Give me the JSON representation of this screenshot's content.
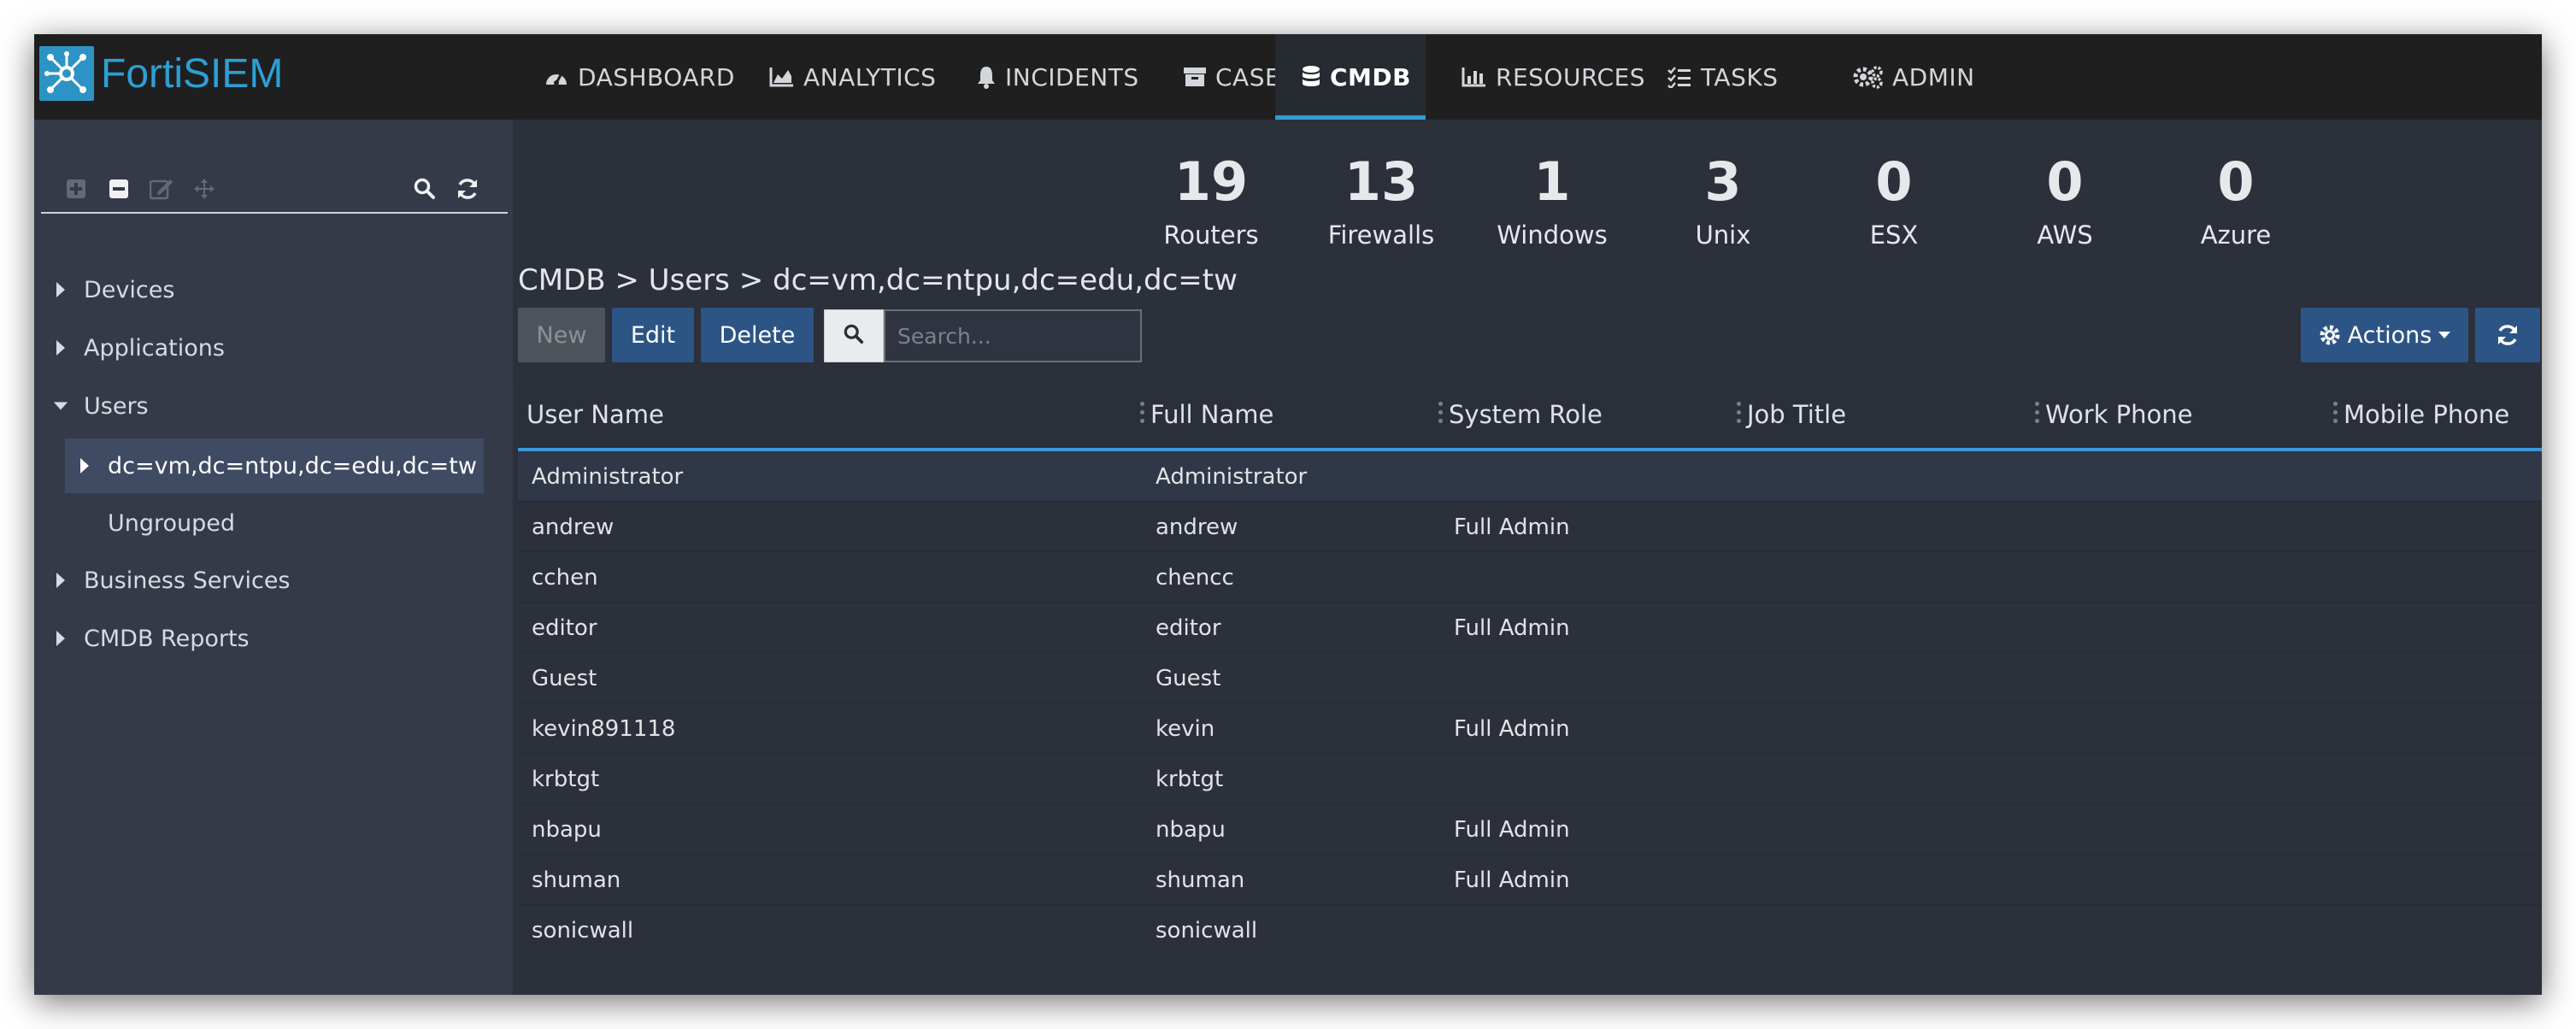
{
  "app": {
    "logo_text": "FortiSIEM"
  },
  "nav": [
    {
      "label": "DASHBOARD",
      "icon": "dashboard-icon"
    },
    {
      "label": "ANALYTICS",
      "icon": "analytics-chart-icon"
    },
    {
      "label": "INCIDENTS",
      "icon": "bell-icon"
    },
    {
      "label": "CASES",
      "icon": "archive-icon"
    },
    {
      "label": "CMDB",
      "icon": "database-icon",
      "active": true
    },
    {
      "label": "RESOURCES",
      "icon": "bar-chart-icon"
    },
    {
      "label": "TASKS",
      "icon": "task-list-icon"
    },
    {
      "label": "ADMIN",
      "icon": "gears-icon"
    }
  ],
  "sidebar": {
    "tools": [
      "add-icon",
      "remove-icon",
      "edit-icon",
      "move-icon",
      "search-icon",
      "refresh-icon"
    ],
    "tree": [
      {
        "label": "Devices",
        "state": "collapsed"
      },
      {
        "label": "Applications",
        "state": "collapsed"
      },
      {
        "label": "Users",
        "state": "expanded"
      },
      {
        "label": "dc=vm,dc=ntpu,dc=edu,dc=tw",
        "state": "collapsed",
        "child": true,
        "selected": true
      },
      {
        "label": "Ungrouped",
        "state": "leaf",
        "child": true
      },
      {
        "label": "Business Services",
        "state": "collapsed"
      },
      {
        "label": "CMDB Reports",
        "state": "collapsed"
      }
    ]
  },
  "stats": [
    {
      "value": "19",
      "label": "Routers"
    },
    {
      "value": "13",
      "label": "Firewalls"
    },
    {
      "value": "1",
      "label": "Windows"
    },
    {
      "value": "3",
      "label": "Unix"
    },
    {
      "value": "0",
      "label": "ESX"
    },
    {
      "value": "0",
      "label": "AWS"
    },
    {
      "value": "0",
      "label": "Azure"
    }
  ],
  "breadcrumb": "CMDB > Users > dc=vm,dc=ntpu,dc=edu,dc=tw",
  "toolbar": {
    "new_label": "New",
    "edit_label": "Edit",
    "delete_label": "Delete",
    "search_placeholder": "Search...",
    "actions_label": "Actions"
  },
  "table": {
    "columns": [
      "User Name",
      "Full Name",
      "System Role",
      "Job Title",
      "Work Phone",
      "Mobile Phone"
    ],
    "rows": [
      [
        "Administrator",
        "Administrator",
        "",
        "",
        "",
        ""
      ],
      [
        "andrew",
        "andrew",
        "Full Admin",
        "",
        "",
        ""
      ],
      [
        "cchen",
        "chencc",
        "",
        "",
        "",
        ""
      ],
      [
        "editor",
        "editor",
        "Full Admin",
        "",
        "",
        ""
      ],
      [
        "Guest",
        "Guest",
        "",
        "",
        "",
        ""
      ],
      [
        "kevin891118",
        "kevin",
        "Full Admin",
        "",
        "",
        ""
      ],
      [
        "krbtgt",
        "krbtgt",
        "",
        "",
        "",
        ""
      ],
      [
        "nbapu",
        "nbapu",
        "Full Admin",
        "",
        "",
        ""
      ],
      [
        "shuman",
        "shuman",
        "Full Admin",
        "",
        "",
        ""
      ],
      [
        "sonicwall",
        "sonicwall",
        "",
        "",
        "",
        ""
      ]
    ]
  },
  "colors": {
    "accent": "#2d9fd6",
    "primary_button": "#2c5585",
    "nav_bg": "#1f1f1f",
    "sidebar_bg": "#343a48",
    "content_bg": "#2b303b"
  }
}
